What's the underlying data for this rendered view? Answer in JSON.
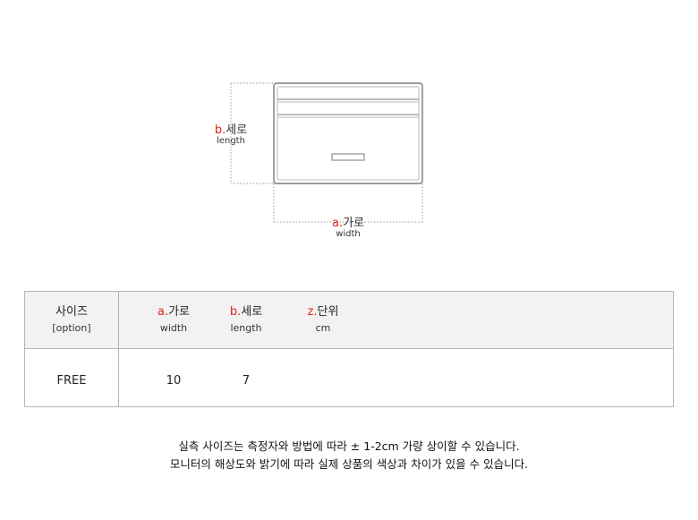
{
  "diagram": {
    "length_label": {
      "letter": "b.",
      "ko": "세로",
      "en": "length"
    },
    "width_label": {
      "letter": "a.",
      "ko": "가로",
      "en": "width"
    }
  },
  "table": {
    "header": {
      "size": {
        "ko": "사이즈",
        "en": "[option]"
      },
      "width": {
        "letter": "a.",
        "ko": "가로",
        "en": "width"
      },
      "length": {
        "letter": "b.",
        "ko": "세로",
        "en": "length"
      },
      "unit": {
        "letter": "z.",
        "ko": "단위",
        "en": "cm"
      }
    },
    "row": {
      "size": "FREE",
      "width": "10",
      "length": "7"
    }
  },
  "notes": [
    "실측 사이즈는 측정자와 방법에 따라 ± 1-2cm 가량 상이할 수 있습니다.",
    "모니터의 해상도와 밝기에 따라 실제 상품의 색상과 차이가 있을 수 있습니다."
  ],
  "colors": {
    "accent": "#e0241f",
    "border": "#b5b5b5",
    "header_bg": "#f2f2f2"
  }
}
